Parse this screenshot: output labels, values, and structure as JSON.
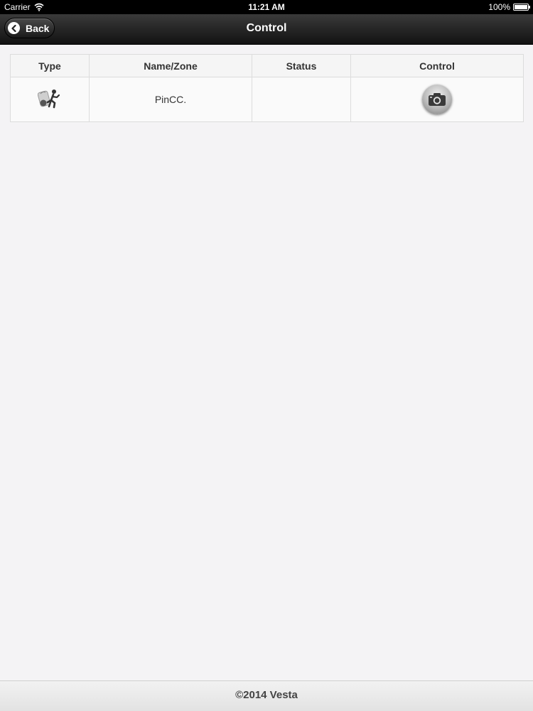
{
  "statusbar": {
    "carrier": "Carrier",
    "time": "11:21 AM",
    "battery": "100%"
  },
  "navbar": {
    "back_label": "Back",
    "title": "Control"
  },
  "table": {
    "headers": {
      "type": "Type",
      "name_zone": "Name/Zone",
      "status": "Status",
      "control": "Control"
    },
    "rows": [
      {
        "type_icon": "panic-device-icon",
        "name_zone": "PinCC.",
        "status": "",
        "control_icon": "camera-icon"
      }
    ]
  },
  "footer": {
    "text": "©2014 Vesta"
  },
  "colors": {
    "navbar": "#1e1e1e",
    "background": "#f4f3f5",
    "footer": "#e8e8e8"
  }
}
